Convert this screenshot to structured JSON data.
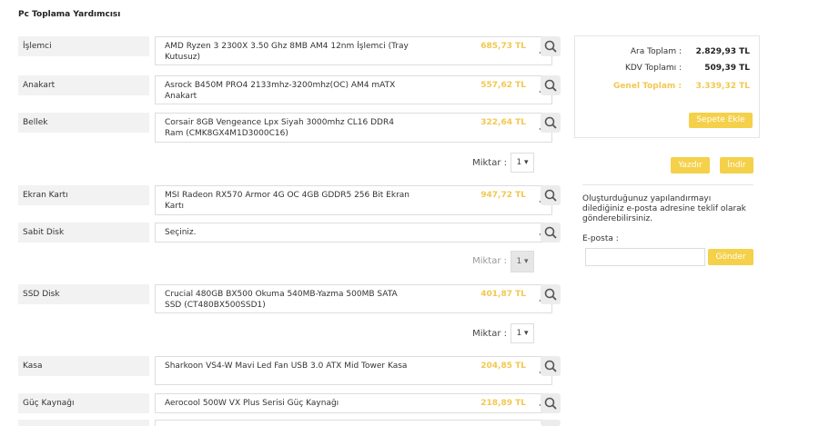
{
  "page": {
    "title": "Pc Toplama Yardımcısı"
  },
  "components": [
    {
      "label": "İşlemci",
      "product": "AMD Ryzen 3 2300X 3.50 Ghz 8MB AM4 12nm İşlemci (Tray Kutusuz)",
      "price": "685,73 TL"
    },
    {
      "label": "Anakart",
      "product": "Asrock B450M PRO4 2133mhz-3200mhz(OC) AM4 mATX Anakart",
      "price": "557,62 TL"
    },
    {
      "label": "Bellek",
      "product": "Corsair 8GB Vengeance Lpx Siyah 3000mhz CL16 DDR4 Ram (CMK8GX4M1D3000C16)",
      "price": "322,64 TL"
    },
    {
      "label": "Ekran Kartı",
      "product": "MSI Radeon RX570 Armor 4G OC 4GB GDDR5 256 Bit Ekran Kartı",
      "price": "947,72 TL"
    },
    {
      "label": "Sabit Disk",
      "product": "Seçiniz.",
      "price": ""
    },
    {
      "label": "SSD Disk",
      "product": "Crucial 480GB BX500 Okuma 540MB-Yazma 500MB SATA SSD (CT480BX500SSD1)",
      "price": "401,87 TL"
    },
    {
      "label": "Kasa",
      "product": "Sharkoon VS4-W Mavi Led Fan USB 3.0 ATX Mid Tower Kasa",
      "price": "204,85 TL"
    },
    {
      "label": "Güç Kaynağı",
      "product": "Aerocool 500W VX Plus Serisi Güç Kaynağı",
      "price": "218,89 TL"
    }
  ],
  "quantity": {
    "label": "Miktar :",
    "value": "1"
  },
  "summary": {
    "subtotal_label": "Ara Toplam :",
    "subtotal": "2.829,93 TL",
    "vat_label": "KDV Toplamı :",
    "vat": "509,39 TL",
    "total_label": "Genel Toplam :",
    "total": "3.339,32 TL",
    "add_to_cart": "Sepete Ekle"
  },
  "actions": {
    "print": "Yazdır",
    "download": "İndir"
  },
  "email": {
    "text": "Oluşturduğunuz yapılandırmayı dilediğiniz e-posta adresine teklif olarak gönderebilirsiniz.",
    "label": "E-posta :",
    "value": "",
    "send": "Gönder"
  },
  "colors": {
    "accent": "#f5d04a",
    "price": "#f3c74f"
  }
}
